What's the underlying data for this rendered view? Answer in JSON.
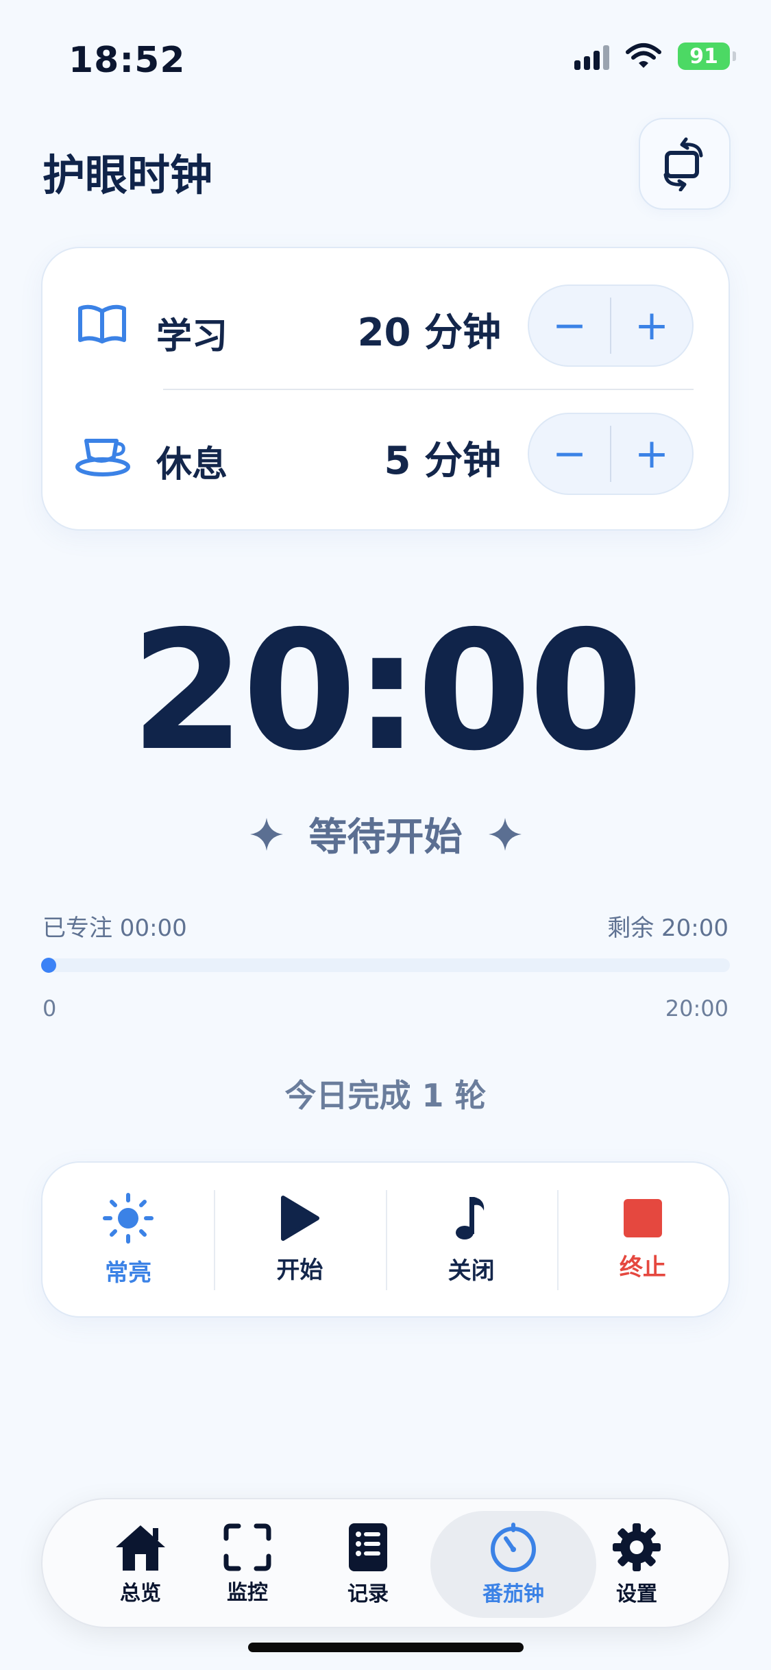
{
  "status_bar": {
    "time": "18:52",
    "battery": "91"
  },
  "header": {
    "title": "护眼时钟",
    "rotate_icon": "rotate-screen-icon"
  },
  "settings": {
    "study": {
      "label": "学习",
      "value": "20 分钟",
      "icon": "book-icon",
      "minus": "−",
      "plus": "+"
    },
    "rest": {
      "label": "休息",
      "value": "5 分钟",
      "icon": "teacup-icon",
      "minus": "−",
      "plus": "+"
    }
  },
  "timer": {
    "display": "20:00",
    "state": "等待开始"
  },
  "progress": {
    "focused": "已专注 00:00",
    "remaining": "剩余 20:00",
    "start_label": "0",
    "end_label": "20:00",
    "fraction": 0
  },
  "today": {
    "text": "今日完成 1 轮"
  },
  "actions": [
    {
      "label": "常亮",
      "icon": "sun-icon"
    },
    {
      "label": "开始",
      "icon": "play-icon"
    },
    {
      "label": "关闭",
      "icon": "music-note-icon"
    },
    {
      "label": "终止",
      "icon": "stop-icon"
    }
  ],
  "tabs": [
    {
      "label": "总览",
      "icon": "house-icon"
    },
    {
      "label": "监控",
      "icon": "viewfinder-icon"
    },
    {
      "label": "记录",
      "icon": "list-icon"
    },
    {
      "label": "番茄钟",
      "icon": "timer-icon",
      "active": true
    },
    {
      "label": "设置",
      "icon": "gear-icon"
    }
  ],
  "colors": {
    "accent": "#3b82e6",
    "text": "#10244a",
    "stop": "#e5483f",
    "background": "#f5f9fe"
  }
}
